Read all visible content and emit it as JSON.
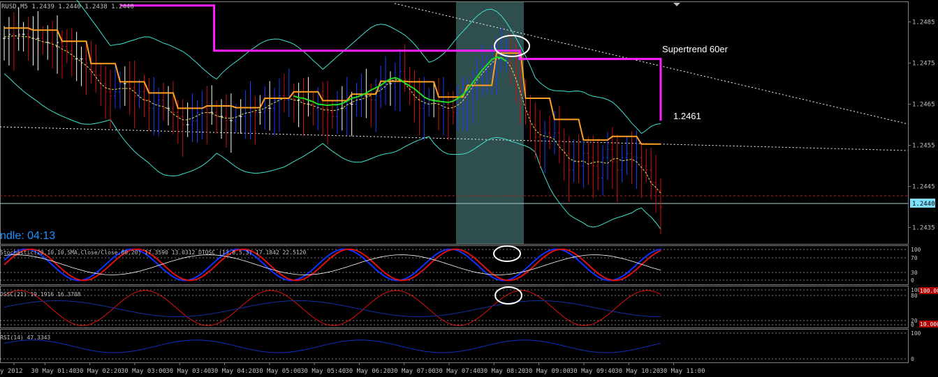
{
  "chart_data": {
    "type": "candlestick",
    "symbol_header": "RUSD,M5  1.2439 1.2440 1.2438 1.2440",
    "current_price_label": "1.2440",
    "candle_timer": "ndle:  04:13",
    "supertrend_label": "Supertrend 60er",
    "supertrend_value": "1.2461",
    "y_ticks": [
      "1.2485",
      "1.2475",
      "1.2465",
      "1.2455",
      "1.2445",
      "1.2435"
    ],
    "x_ticks": [
      "y 2012",
      "30 May 01:40",
      "30 May 02:20",
      "30 May 03:00",
      "30 May 03:40",
      "30 May 04:20",
      "30 May 05:00",
      "30 May 05:40",
      "30 May 06:20",
      "30 May 07:00",
      "30 May 07:40",
      "30 May 08:20",
      "30 May 09:00",
      "30 May 09:40",
      "30 May 10:20",
      "30 May 11:00"
    ],
    "ylim": [
      1.2431,
      1.249
    ],
    "highlight_zone": {
      "from": "30 May 07:40",
      "to": "30 May 08:25"
    },
    "candles_close": [
      1.2481,
      1.2482,
      1.2481,
      1.2482,
      1.2482,
      1.2481,
      1.2481,
      1.2481,
      1.248,
      1.248,
      1.2479,
      1.248,
      1.2479,
      1.2478,
      1.2476,
      1.2476,
      1.2476,
      1.2475,
      1.2473,
      1.2472,
      1.247,
      1.2468,
      1.2467,
      1.2468,
      1.247,
      1.247,
      1.2469,
      1.2467,
      1.2468,
      1.2466,
      1.2464,
      1.2465,
      1.2466,
      1.2464,
      1.2464,
      1.2463,
      1.2462,
      1.246,
      1.246,
      1.2461,
      1.2463,
      1.2464,
      1.2463,
      1.2463,
      1.2462,
      1.2462,
      1.2461,
      1.2461,
      1.2462,
      1.2462,
      1.2463,
      1.2464,
      1.2463,
      1.2463,
      1.2464,
      1.2464,
      1.2466,
      1.2467,
      1.2466,
      1.2467,
      1.2466,
      1.2466,
      1.2465,
      1.2465,
      1.2464,
      1.2465,
      1.2464,
      1.2463,
      1.2462,
      1.2464,
      1.2464,
      1.2465,
      1.2465,
      1.2466,
      1.2467,
      1.2467,
      1.2466,
      1.2467,
      1.2469,
      1.247,
      1.247,
      1.2471,
      1.2473,
      1.2471,
      1.2469,
      1.2466,
      1.2464,
      1.2465,
      1.2466,
      1.2466,
      1.2464,
      1.2465,
      1.2464,
      1.2463,
      1.2464,
      1.2465,
      1.2468,
      1.2469,
      1.2471,
      1.2473,
      1.2474,
      1.2475,
      1.2476,
      1.2477,
      1.2478,
      1.2475,
      1.2472,
      1.2468,
      1.2463,
      1.246,
      1.2457,
      1.2456,
      1.2458,
      1.2457,
      1.2458,
      1.2456,
      1.2453,
      1.2449,
      1.2451,
      1.245,
      1.2453,
      1.2452,
      1.245,
      1.2447,
      1.2452,
      1.2454,
      1.2451,
      1.2449,
      1.2452,
      1.2453,
      1.2451,
      1.2452,
      1.245,
      1.2449,
      1.2446,
      1.2444,
      1.244
    ],
    "supertrend_60": [
      1.2489,
      1.2489,
      1.2489,
      1.2489,
      1.2478,
      1.2478,
      1.2478,
      1.2478,
      1.2478,
      1.2478,
      1.2478,
      1.2478,
      1.2478,
      1.2478,
      1.2478,
      1.2478,
      1.2478,
      1.2476,
      1.2476,
      1.2476,
      1.2476,
      1.2476,
      1.2476,
      1.2461
    ],
    "indicators": [
      {
        "name": "Stochastic(20,10,10,SMA,Close/Close,80,20) 17.3590 13.0312  DTOSC (13,8,5,3) 17.1842 22.5120",
        "levels": [
          "100",
          "70",
          "30",
          "0"
        ]
      },
      {
        "name": "DSSC(21) 19.1916 16.3708",
        "levels": [
          "100",
          "80",
          "20",
          "0"
        ],
        "side_labels": [
          "100.0000",
          "10.0000"
        ]
      },
      {
        "name": "RSI(14) 47.3343",
        "levels": [
          "100",
          "0"
        ]
      }
    ]
  }
}
